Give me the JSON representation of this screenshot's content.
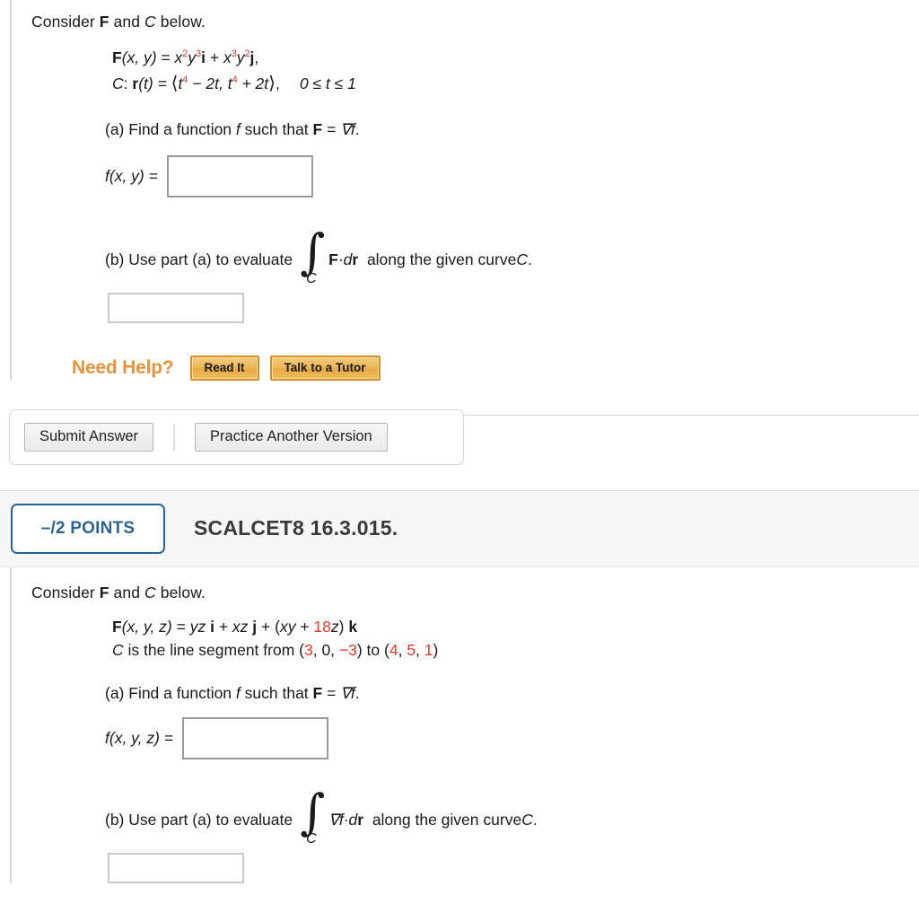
{
  "problem1": {
    "intro": {
      "prefix": "Consider ",
      "bold_F": "F",
      "mid": " and ",
      "italic_C": "C",
      "suffix": " below."
    },
    "formula_F": {
      "head": "F",
      "args": "(x, y)",
      "eq": " = ",
      "term1_base": "x",
      "term1_exp": "2",
      "term1_var": "y",
      "term1_var_exp": "3",
      "term1_unit": "i",
      "plus": " + ",
      "term2_base": "x",
      "term2_exp": "3",
      "term2_var": "y",
      "term2_var_exp": "2",
      "term2_unit": "j",
      "tail": ","
    },
    "formula_C": {
      "label": "C",
      "colon": ": ",
      "r": "r",
      "args": "(t) = ",
      "open": "⟨",
      "p1_base": "t",
      "p1_exp": "4",
      "p1_rest": " − 2t, ",
      "p2_base": "t",
      "p2_exp": "4",
      "p2_rest": " + 2t",
      "close": "⟩",
      "comma": ",",
      "range": "0 ≤ t ≤ 1"
    },
    "part_a": {
      "prefix": "(a) Find a function ",
      "f": "f",
      "mid": " such that ",
      "F": "F",
      "eq": " = ",
      "grad": "∇f",
      "period": "."
    },
    "answer_a_label": "f(x, y) =",
    "part_b": {
      "prefix": "(b) Use part (a) to evaluate",
      "integrand_F": "F",
      "dot": " · ",
      "dr_d": "d",
      "dr_r": "r",
      "suffix": "along the given curve ",
      "curve": "C",
      "period": ".",
      "integral_glyph": "∫",
      "integral_sub": "C"
    },
    "need_help": {
      "label": "Need Help?",
      "read_it": "Read It",
      "talk_to_tutor": "Talk to a Tutor"
    },
    "actions": {
      "submit": "Submit Answer",
      "practice": "Practice Another Version"
    }
  },
  "problem2": {
    "header": {
      "points": "–/2 POINTS",
      "title": "SCALCET8 16.3.015."
    },
    "intro": {
      "prefix": "Consider ",
      "bold_F": "F",
      "mid": " and ",
      "italic_C": "C",
      "suffix": " below."
    },
    "formula_F": {
      "head": "F",
      "args": "(x, y, z)",
      "eq": " = ",
      "t1": "yz",
      "u1": "i",
      "plus1": " + ",
      "t2": "xz",
      "u2": "j",
      "plus2": " + (",
      "t3": "xy",
      "plus3": " + ",
      "coef": "18",
      "t3b": "z",
      "closeparen": ") ",
      "u3": "k"
    },
    "formula_C": {
      "label": "C",
      "text1": " is the line segment from (",
      "p1x": "3",
      "c1": ", ",
      "p1y": "0",
      "c2": ", ",
      "p1z": "−3",
      "text2": ") to (",
      "p2x": "4",
      "c3": ", ",
      "p2y": "5",
      "c4": ", ",
      "p2z": "1",
      "text3": ")"
    },
    "part_a": {
      "prefix": "(a) Find a function ",
      "f": "f",
      "mid": " such that ",
      "F": "F",
      "eq": " = ",
      "grad": "∇f",
      "period": "."
    },
    "answer_a_label": "f(x, y, z) =",
    "part_b": {
      "prefix": "(b) Use part (a) to evaluate",
      "integrand_grad": "∇f",
      "dot": " · ",
      "dr_d": "d",
      "dr_r": "r",
      "suffix": "along the given curve ",
      "curve": "C",
      "period": ".",
      "integral_glyph": "∫",
      "integral_sub": "C"
    }
  },
  "colors": {
    "red": "#e8382b",
    "orange": "#e8923a",
    "blue": "#2a6496",
    "gold_button": "#e8a93f"
  }
}
